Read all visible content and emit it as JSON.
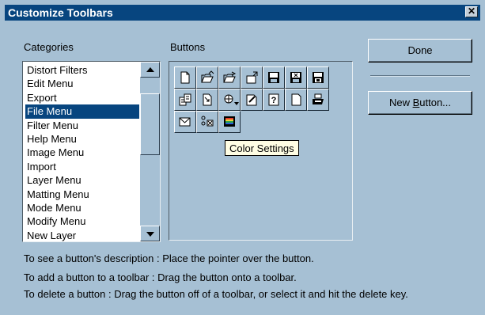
{
  "window": {
    "title": "Customize Toolbars",
    "close_glyph": "✕"
  },
  "labels": {
    "categories": "Categories",
    "buttons": "Buttons"
  },
  "categories": {
    "items": [
      "Distort Filters",
      "Edit Menu",
      "Export",
      "File Menu",
      "Filter Menu",
      "Help Menu",
      "Image Menu",
      "Import",
      "Layer Menu",
      "Matting Menu",
      "Mode Menu",
      "Modify Menu",
      "New Layer"
    ],
    "selected": "File Menu"
  },
  "toolbar_buttons": [
    {
      "icon": "new-document-icon"
    },
    {
      "icon": "open-folder-icon"
    },
    {
      "icon": "open-folder-alt-icon"
    },
    {
      "icon": "export-box-icon"
    },
    {
      "icon": "save-disk-icon"
    },
    {
      "icon": "save-disk-x-icon"
    },
    {
      "icon": "save-disk-alt-icon"
    },
    {
      "icon": "copy-documents-icon"
    },
    {
      "icon": "document-arrow-icon"
    },
    {
      "icon": "color-drop-icon"
    },
    {
      "icon": "document-edit-icon"
    },
    {
      "icon": "help-question-icon"
    },
    {
      "icon": "page-icon"
    },
    {
      "icon": "printer-icon"
    },
    {
      "icon": "mail-icon"
    },
    {
      "icon": "scan-devices-icon"
    },
    {
      "icon": "color-settings-icon"
    }
  ],
  "tooltip": "Color Settings",
  "actions": {
    "done": "Done",
    "new_button_pre": "New ",
    "new_button_key": "B",
    "new_button_post": "utton..."
  },
  "help_lines": [
    "To see a button's description : Place the pointer over the button.",
    "To add a button to a toolbar : Drag the button onto a toolbar.",
    "To delete a button : Drag the button off of a toolbar, or select it and hit the delete key."
  ],
  "colors": {
    "title_bar": "#07457f",
    "dialog_bg": "#a6c0d4",
    "selection": "#07457f",
    "tooltip_bg": "#fffee4"
  }
}
